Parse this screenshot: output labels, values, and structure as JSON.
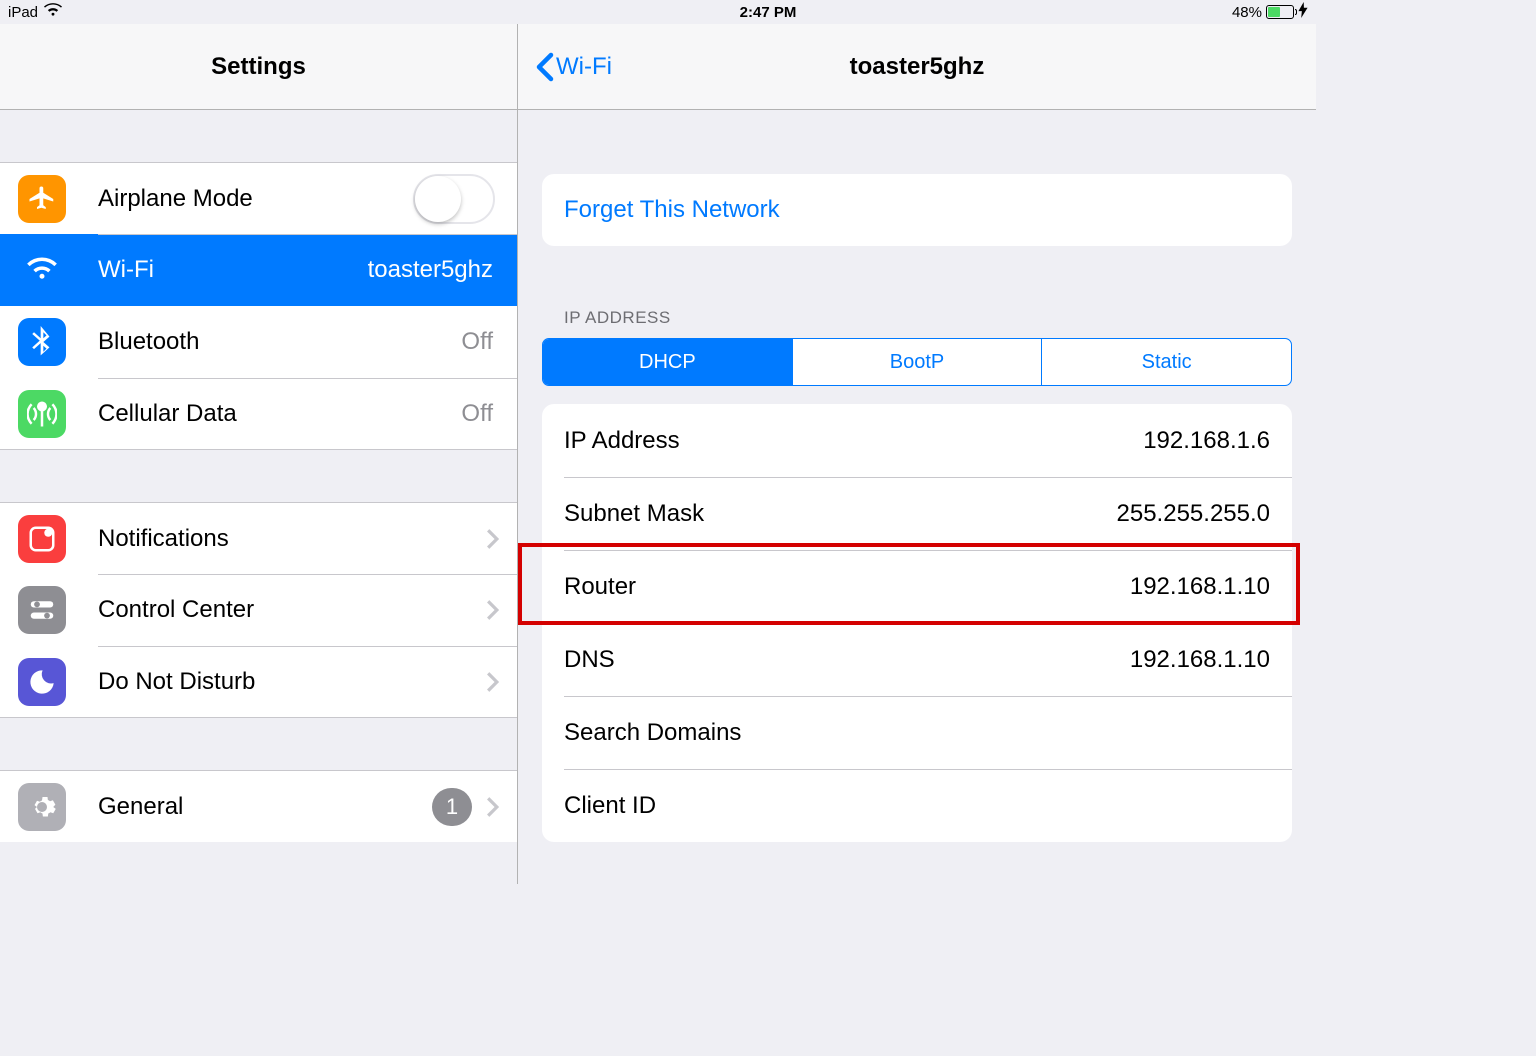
{
  "status": {
    "device": "iPad",
    "time": "2:47 PM",
    "battery_text": "48%"
  },
  "sidebar": {
    "title": "Settings",
    "group1": [
      {
        "label": "Airplane Mode"
      },
      {
        "label": "Wi-Fi",
        "value": "toaster5ghz"
      },
      {
        "label": "Bluetooth",
        "value": "Off"
      },
      {
        "label": "Cellular Data",
        "value": "Off"
      }
    ],
    "group2": [
      {
        "label": "Notifications"
      },
      {
        "label": "Control Center"
      },
      {
        "label": "Do Not Disturb"
      }
    ],
    "group3": [
      {
        "label": "General",
        "badge": "1"
      }
    ]
  },
  "detail": {
    "back_label": "Wi-Fi",
    "title": "toaster5ghz",
    "forget_label": "Forget This Network",
    "ip_section_header": "IP ADDRESS",
    "seg": {
      "dhcp": "DHCP",
      "bootp": "BootP",
      "static": "Static"
    },
    "kv": [
      {
        "label": "IP Address",
        "value": "192.168.1.6"
      },
      {
        "label": "Subnet Mask",
        "value": "255.255.255.0"
      },
      {
        "label": "Router",
        "value": "192.168.1.10"
      },
      {
        "label": "DNS",
        "value": "192.168.1.10"
      },
      {
        "label": "Search Domains",
        "value": ""
      },
      {
        "label": "Client ID",
        "value": ""
      }
    ]
  }
}
